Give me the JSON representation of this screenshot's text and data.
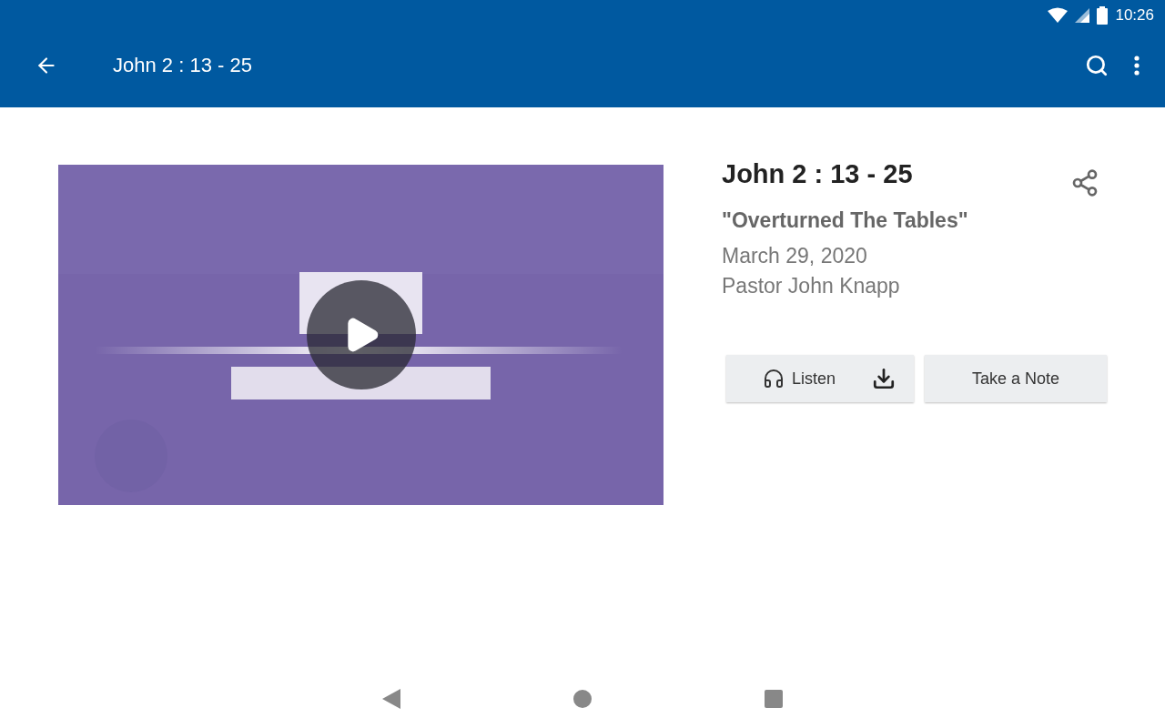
{
  "status_bar": {
    "time": "10:26"
  },
  "app_bar": {
    "title": "John 2 : 13 - 25"
  },
  "sermon": {
    "title": "John 2 : 13 - 25",
    "subtitle": "\"Overturned The Tables\"",
    "date": "March 29, 2020",
    "speaker": "Pastor John Knapp"
  },
  "actions": [
    {
      "kind": "listen",
      "label": "Listen"
    },
    {
      "kind": "note",
      "label": "Take a Note"
    }
  ]
}
